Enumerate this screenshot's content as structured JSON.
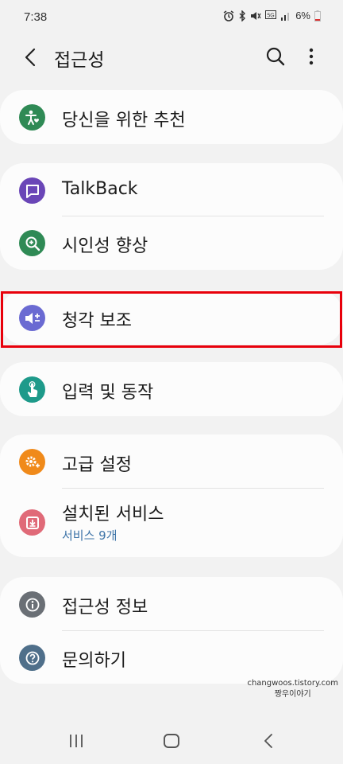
{
  "status_bar": {
    "time": "7:38",
    "battery": "6%"
  },
  "app_bar": {
    "title": "접근성"
  },
  "sections": [
    {
      "items": [
        {
          "label": "당신을 위한 추천",
          "icon": "accessibility-person-icon",
          "color": "#2f8a55"
        }
      ]
    },
    {
      "items": [
        {
          "label": "TalkBack",
          "icon": "chat-bubble-icon",
          "color": "#6a46b7"
        },
        {
          "label": "시인성 향상",
          "icon": "magnifier-plus-icon",
          "color": "#2f8a55"
        }
      ]
    },
    {
      "items": [
        {
          "label": "청각 보조",
          "icon": "speaker-plus-icon",
          "color": "#6a6ad2"
        }
      ]
    },
    {
      "items": [
        {
          "label": "입력 및 동작",
          "icon": "hand-tap-icon",
          "color": "#1e9a8a"
        }
      ]
    },
    {
      "items": [
        {
          "label": "고급 설정",
          "icon": "gear-plus-icon",
          "color": "#f08a1a"
        },
        {
          "label": "설치된 서비스",
          "sublabel": "서비스 9개",
          "icon": "download-box-icon",
          "color": "#e06a78"
        }
      ]
    },
    {
      "items": [
        {
          "label": "접근성 정보",
          "icon": "info-icon",
          "color": "#6a6f75"
        },
        {
          "label": "문의하기",
          "icon": "question-icon",
          "color": "#4f6f8a"
        }
      ]
    }
  ],
  "watermark": {
    "line1": "changwoos.tistory.com",
    "line2": "짱우이야기"
  },
  "colors": {
    "background": "#f2f2f2",
    "card": "#fcfcfc",
    "highlight": "#e8000b",
    "link": "#3e74a8"
  }
}
